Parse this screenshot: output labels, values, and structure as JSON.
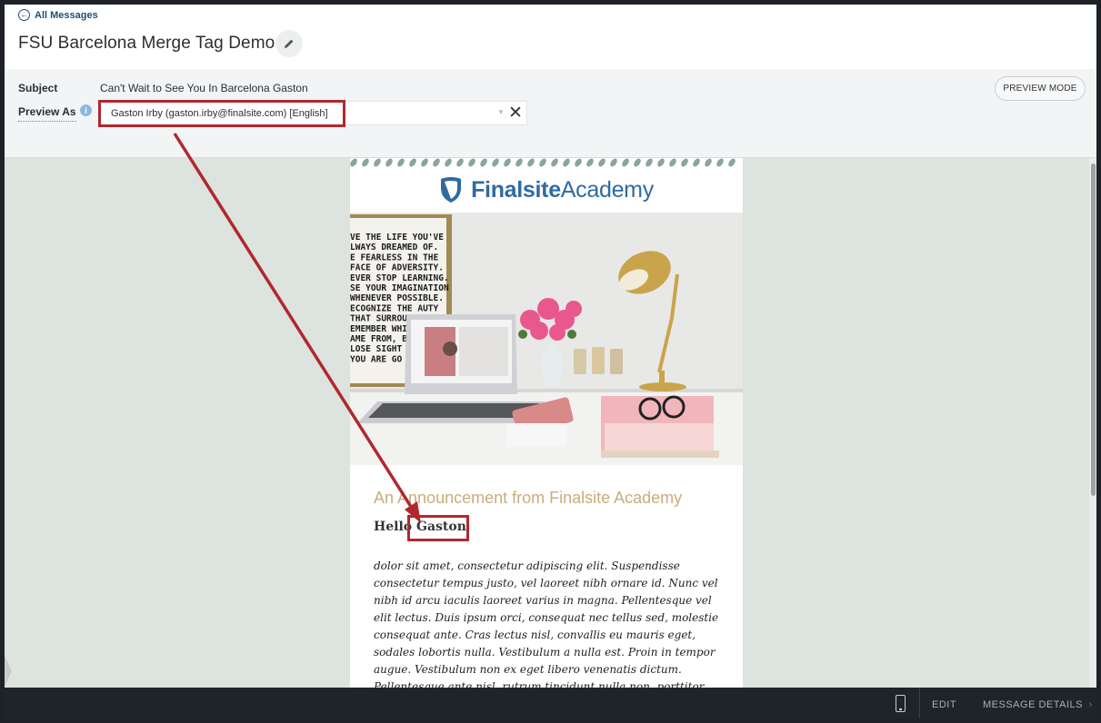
{
  "header": {
    "back_label": "All Messages",
    "title": "FSU Barcelona Merge Tag Demo"
  },
  "subject_panel": {
    "subject_label": "Subject",
    "subject_value": "Can't Wait to See You In Barcelona Gaston",
    "preview_as_label": "Preview As",
    "info_icon": "i",
    "preview_as_value": "Gaston Irby (gaston.irby@finalsite.com) [English]",
    "clear_icon": "✕",
    "preview_mode_label": "PREVIEW MODE"
  },
  "email": {
    "logo_bold": "Finalsite",
    "logo_light": "Academy",
    "hero_poster_text": [
      "VE THE LIFE YOU'VE",
      "LWAYS DREAMED OF.",
      "E FEARLESS IN THE",
      "FACE OF ADVERSITY.",
      "EVER STOP LEARNING.",
      "SE YOUR IMAGINATION",
      "WHENEVER POSSIBLE.",
      "ECOGNIZE THE AUTY",
      "THAT SURROUN",
      "EMEMBER WHI",
      "AME FROM, BU",
      "LOSE SIGHT OF",
      "YOU ARE GO"
    ],
    "announcement_title": "An Announcement from Finalsite Academy",
    "hello_prefix": "Hello",
    "hello_name": "Gaston",
    "body_text": "dolor sit amet, consectetur adipiscing elit. Suspendisse consectetur tempus justo, vel laoreet nibh ornare id. Nunc vel nibh id arcu iaculis laoreet varius in magna. Pellentesque vel elit lectus. Duis ipsum orci, consequat nec tellus sed, molestie consequat ante. Cras lectus nisl, convallis eu mauris eget, sodales lobortis nulla. Vestibulum a nulla est. Proin in tempor augue. Vestibulum non ex eget libero venenatis dictum. Pellentesque ante nisl, rutrum tincidunt nulla non, porttitor interdum metus. Nunc maximus quis"
  },
  "footer": {
    "edit_label": "EDIT",
    "message_details_label": "MESSAGE DETAILS",
    "chevron_icon": "›"
  },
  "colors": {
    "annotation_red": "#b0282e",
    "brand_blue": "#2f6aa3",
    "announcement_gold": "#c9ad7a"
  }
}
